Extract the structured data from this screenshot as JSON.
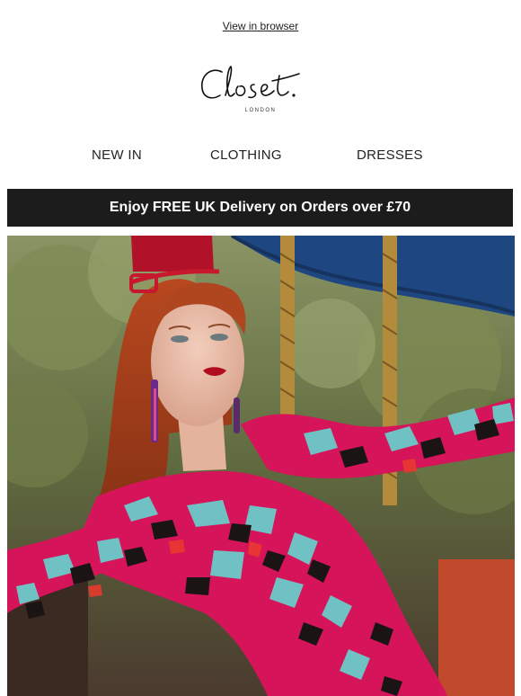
{
  "header": {
    "view_in_browser": "View in browser"
  },
  "logo": {
    "brand": "Closet.",
    "location": "LONDON"
  },
  "nav": {
    "items": [
      {
        "label": "NEW IN"
      },
      {
        "label": "CLOTHING"
      },
      {
        "label": "DRESSES"
      }
    ]
  },
  "banner": {
    "text": "Enjoy FREE UK Delivery on Orders over £70"
  },
  "hero": {
    "description": "model-in-pink-leopard-print-dress",
    "colors": {
      "pink": "#d6145a",
      "teal": "#6fc1c4",
      "black": "#1a1414",
      "hair": "#a6401c",
      "foliage": "#6d7a4a",
      "canopy": "#1e4680"
    }
  }
}
